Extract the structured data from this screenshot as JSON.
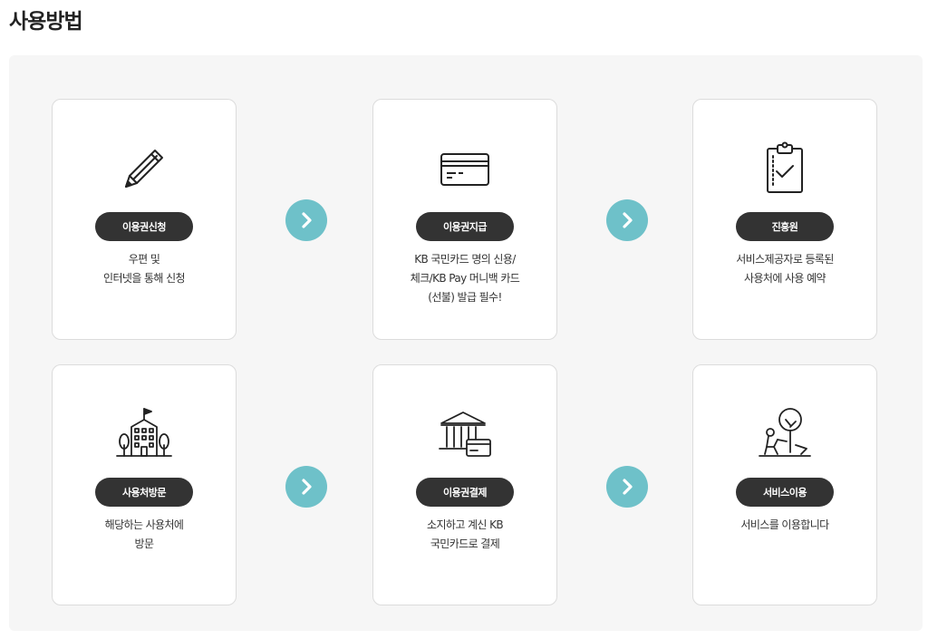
{
  "page": {
    "title": "사용방법"
  },
  "steps": [
    {
      "label": "이용권신청",
      "icon": "pencil-icon",
      "desc": [
        "우편 및",
        "인터넷을 통해 신청"
      ]
    },
    {
      "label": "이용권지급",
      "icon": "credit-card-icon",
      "desc": [
        "KB 국민카드 명의 신용/",
        "체크/KB Pay 머니백 카드",
        "(선불) 발급 필수!"
      ]
    },
    {
      "label": "진흥원",
      "icon": "clipboard-check-icon",
      "desc": [
        "서비스제공자로 등록된",
        "사용처에 사용 예약"
      ]
    },
    {
      "label": "사용처방문",
      "icon": "building-icon",
      "desc": [
        "해당하는 사용처에",
        "방문"
      ]
    },
    {
      "label": "이용권결제",
      "icon": "bank-card-icon",
      "desc": [
        "소지하고 계신 KB",
        "국민카드로 결제"
      ]
    },
    {
      "label": "서비스이용",
      "icon": "person-service-icon",
      "desc": [
        "서비스를 이용합니다"
      ]
    }
  ],
  "colors": {
    "pill": "#333333",
    "arrow": "#6ec1c9",
    "panel": "#f6f6f6"
  },
  "arrow_icon": "chevron-right-icon"
}
